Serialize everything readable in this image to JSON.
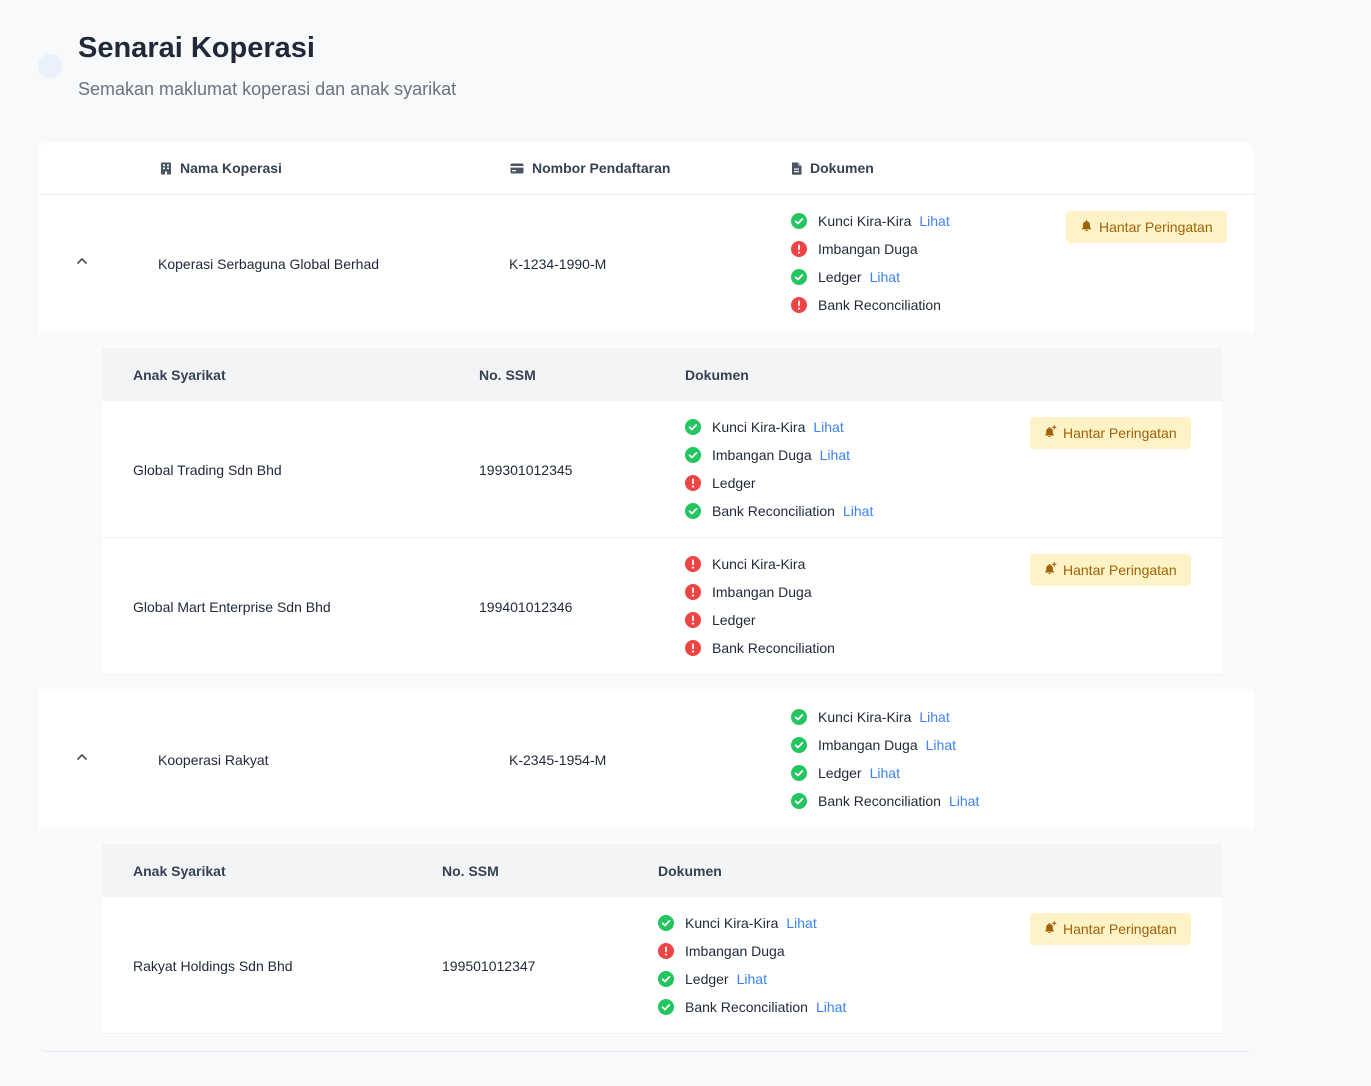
{
  "header": {
    "title": "Senarai Koperasi",
    "subtitle": "Semakan maklumat koperasi dan anak syarikat"
  },
  "table": {
    "columns": {
      "nama": "Nama Koperasi",
      "nombor": "Nombor Pendaftaran",
      "dokumen": "Dokumen"
    },
    "sub_columns": {
      "anak": "Anak Syarikat",
      "ssm": "No. SSM",
      "dokumen": "Dokumen"
    },
    "view_label": "Lihat",
    "action_label": "Hantar Peringatan",
    "koperasi": [
      {
        "name": "Koperasi Serbaguna Global Berhad",
        "reg_no": "K-1234-1990-M",
        "docs": [
          {
            "name": "Kunci Kira-Kira",
            "status": "ok",
            "view": "Lihat"
          },
          {
            "name": "Imbangan Duga",
            "status": "missing"
          },
          {
            "name": "Ledger",
            "status": "ok",
            "view": "Lihat"
          },
          {
            "name": "Bank Reconciliation",
            "status": "missing"
          }
        ],
        "subsidiaries": [
          {
            "name": "Global Trading Sdn Bhd",
            "ssm": "199301012345",
            "docs": [
              {
                "name": "Kunci Kira-Kira",
                "status": "ok",
                "view": "Lihat"
              },
              {
                "name": "Imbangan Duga",
                "status": "ok",
                "view": "Lihat"
              },
              {
                "name": "Ledger",
                "status": "missing"
              },
              {
                "name": "Bank Reconciliation",
                "status": "ok",
                "view": "Lihat"
              }
            ]
          },
          {
            "name": "Global Mart Enterprise Sdn Bhd",
            "ssm": "199401012346",
            "docs": [
              {
                "name": "Kunci Kira-Kira",
                "status": "missing"
              },
              {
                "name": "Imbangan Duga",
                "status": "missing"
              },
              {
                "name": "Ledger",
                "status": "missing"
              },
              {
                "name": "Bank Reconciliation",
                "status": "missing"
              }
            ]
          }
        ]
      },
      {
        "name": "Kooperasi Rakyat",
        "reg_no": "K-2345-1954-M",
        "docs": [
          {
            "name": "Kunci Kira-Kira",
            "status": "ok",
            "view": "Lihat"
          },
          {
            "name": "Imbangan Duga",
            "status": "ok",
            "view": "Lihat"
          },
          {
            "name": "Ledger",
            "status": "ok",
            "view": "Lihat"
          },
          {
            "name": "Bank Reconciliation",
            "status": "ok",
            "view": "Lihat"
          }
        ],
        "subsidiaries": [
          {
            "name": "Rakyat Holdings Sdn Bhd",
            "ssm": "199501012347",
            "docs": [
              {
                "name": "Kunci Kira-Kira",
                "status": "ok",
                "view": "Lihat"
              },
              {
                "name": "Imbangan Duga",
                "status": "missing"
              },
              {
                "name": "Ledger",
                "status": "ok",
                "view": "Lihat"
              },
              {
                "name": "Bank Reconciliation",
                "status": "ok",
                "view": "Lihat"
              }
            ]
          }
        ]
      }
    ]
  },
  "colors": {
    "ok": "#22c55e",
    "missing": "#ef4444",
    "link": "#3b82f6",
    "action_bg": "#fef3c7",
    "action_text": "#a16207"
  }
}
